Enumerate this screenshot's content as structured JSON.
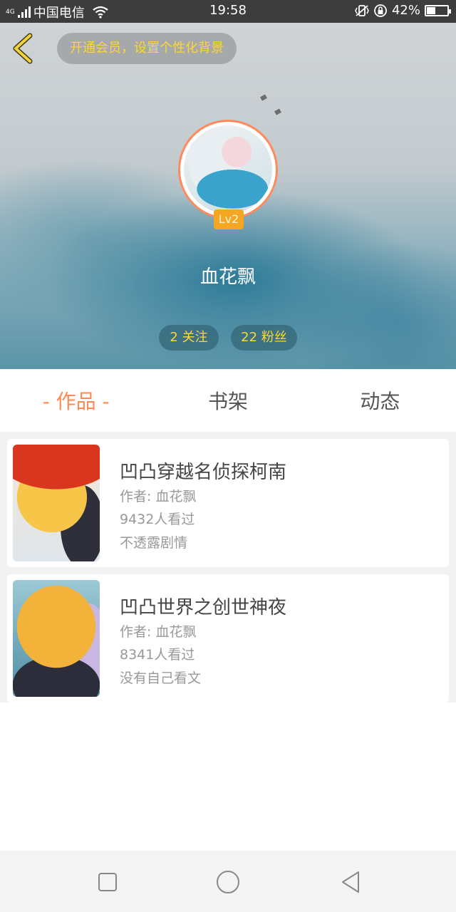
{
  "status_bar": {
    "network_type": "4G",
    "carrier": "中国电信",
    "time": "19:58",
    "battery_percent": "42%",
    "battery_level": 0.42,
    "icons": [
      "signal-icon",
      "wifi-icon",
      "vibrate-icon",
      "rotation-lock-icon",
      "battery-icon"
    ]
  },
  "header": {
    "vip_prompt": "开通会员，设置个性化背景",
    "level": "Lv2",
    "username": "血花飘",
    "following": "2 关注",
    "fans": "22 粉丝"
  },
  "tabs": [
    {
      "label": "- 作品 -",
      "active": true
    },
    {
      "label": "书架",
      "active": false
    },
    {
      "label": "动态",
      "active": false
    }
  ],
  "works": [
    {
      "title": "凹凸穿越名侦探柯南",
      "author": "作者: 血花飘",
      "views": "9432人看过",
      "intro": "不透露剧情"
    },
    {
      "title": "凹凸世界之创世神夜",
      "author": "作者: 血花飘",
      "views": "8341人看过",
      "intro": "没有自己看文"
    }
  ],
  "colors": {
    "accent": "#ff8a50",
    "highlight": "#ffd633",
    "badge": "#f5a623"
  }
}
